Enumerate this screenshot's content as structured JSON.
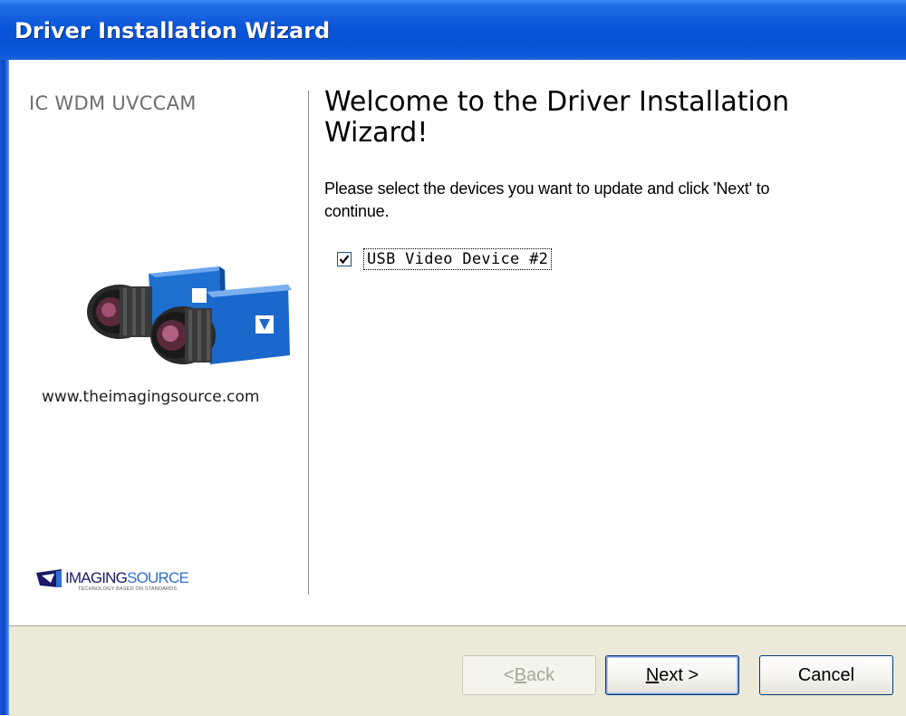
{
  "window": {
    "title": "Driver Installation Wizard"
  },
  "sidebar": {
    "product_name": "IC WDM UVCCAM",
    "website": "www.theimagingsource.com",
    "logo": {
      "text_part1": "IMAGING",
      "text_part2": "SOURCE",
      "tagline": "TECHNOLOGY BASED ON STANDARDS"
    }
  },
  "main": {
    "heading": "Welcome to the Driver Installation Wizard!",
    "instructions": "Please select the devices you want to update and click 'Next' to continue.",
    "devices": [
      {
        "label": "USB Video Device #2",
        "checked": true
      }
    ]
  },
  "buttons": {
    "back": {
      "prefix": "< ",
      "mnemonic": "B",
      "rest": "ack",
      "enabled": false
    },
    "next": {
      "mnemonic": "N",
      "rest": "ext >",
      "enabled": true
    },
    "cancel": {
      "label": "Cancel",
      "enabled": true
    }
  },
  "colors": {
    "titlebar": "#0a56d8",
    "button_bar": "#ece9d8",
    "product_name": "#6d6d6d"
  }
}
